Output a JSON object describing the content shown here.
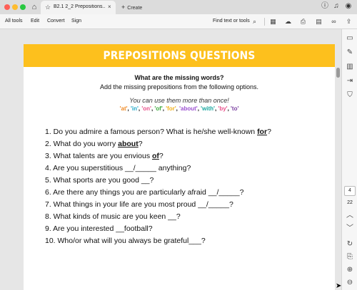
{
  "window": {
    "tab_title": "B2.1 2_2 Prepositions...",
    "tab_close": "×",
    "new_tab_plus": "+",
    "new_tab_label": "Create"
  },
  "toolbar": {
    "menu": [
      "All tools",
      "Edit",
      "Convert",
      "Sign"
    ],
    "find_label": "Find text or tools"
  },
  "document": {
    "banner_title": "PREPOSITIONS QUESTIONS",
    "heading": "What are the missing words?",
    "subheading": "Add the missing prepositions from the following options.",
    "note": "You can use them more than once!",
    "options": [
      {
        "text": "'at'",
        "color": "#f08a24"
      },
      {
        "text": "'in'",
        "color": "#1fa8c9"
      },
      {
        "text": "'on'",
        "color": "#e94f8a"
      },
      {
        "text": "'of'",
        "color": "#3aa83a"
      },
      {
        "text": "'for'",
        "color": "#f2b21b"
      },
      {
        "text": "'about'",
        "color": "#9b4fd1"
      },
      {
        "text": "'with'",
        "color": "#19a7a0"
      },
      {
        "text": "'by'",
        "color": "#e94f8a"
      },
      {
        "text": "'to'",
        "color": "#7a3fa0"
      }
    ],
    "questions": [
      {
        "pre": "1. Do you admire a famous person? What is he/she well-known ",
        "ans": "for",
        "post": "?"
      },
      {
        "pre": "2. What do you worry ",
        "ans": "about",
        "post": "?"
      },
      {
        "pre": "3. What talents are you envious ",
        "ans": "of",
        "post": "?"
      },
      {
        "pre": "4. Are you superstitious __/_____ anything?",
        "ans": "",
        "post": ""
      },
      {
        "pre": "5. What sports are you good __?",
        "ans": "",
        "post": ""
      },
      {
        "pre": "6. Are there any things you are particularly afraid __/_____?",
        "ans": "",
        "post": ""
      },
      {
        "pre": "7. What things in your life are you most proud __/_____?",
        "ans": "",
        "post": ""
      },
      {
        "pre": "8. What kinds of music are you keen __?",
        "ans": "",
        "post": ""
      },
      {
        "pre": "9. Are you interested __football?",
        "ans": "",
        "post": ""
      },
      {
        "pre": "10. Who/or what will you always be grateful___?",
        "ans": "",
        "post": ""
      }
    ]
  },
  "navigation": {
    "current_page": "4",
    "total_pages": "22"
  },
  "colors": {
    "banner": "#fdc01d"
  }
}
